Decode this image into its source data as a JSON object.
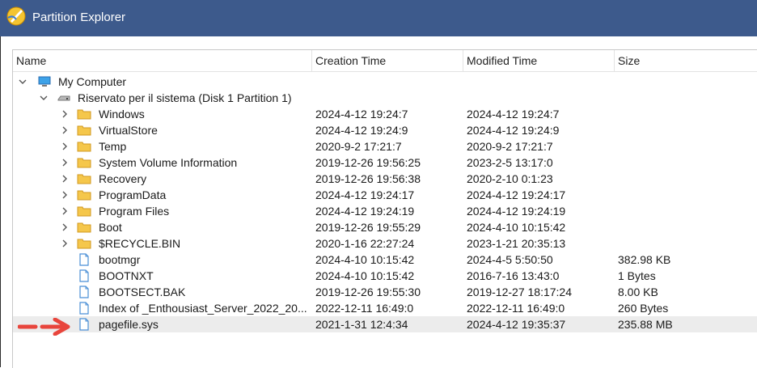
{
  "window": {
    "title": "Partition Explorer"
  },
  "columns": {
    "name": "Name",
    "creation": "Creation Time",
    "modified": "Modified Time",
    "size": "Size"
  },
  "tree": {
    "computer": "My Computer",
    "partition": "Riservato per il sistema (Disk 1 Partition 1)"
  },
  "rows": [
    {
      "name": "Windows",
      "type": "folder",
      "created": "2024-4-12 19:24:7",
      "modified": "2024-4-12 19:24:7",
      "size": ""
    },
    {
      "name": "VirtualStore",
      "type": "folder",
      "created": "2024-4-12 19:24:9",
      "modified": "2024-4-12 19:24:9",
      "size": ""
    },
    {
      "name": "Temp",
      "type": "folder",
      "created": "2020-9-2 17:21:7",
      "modified": "2020-9-2 17:21:7",
      "size": ""
    },
    {
      "name": "System Volume Information",
      "type": "folder",
      "created": "2019-12-26 19:56:25",
      "modified": "2023-2-5 13:17:0",
      "size": ""
    },
    {
      "name": "Recovery",
      "type": "folder",
      "created": "2019-12-26 19:56:38",
      "modified": "2020-2-10 0:1:23",
      "size": ""
    },
    {
      "name": "ProgramData",
      "type": "folder",
      "created": "2024-4-12 19:24:17",
      "modified": "2024-4-12 19:24:17",
      "size": ""
    },
    {
      "name": "Program Files",
      "type": "folder",
      "created": "2024-4-12 19:24:19",
      "modified": "2024-4-12 19:24:19",
      "size": ""
    },
    {
      "name": "Boot",
      "type": "folder",
      "created": "2019-12-26 19:55:29",
      "modified": "2024-4-10 10:15:42",
      "size": ""
    },
    {
      "name": "$RECYCLE.BIN",
      "type": "folder",
      "created": "2020-1-16 22:27:24",
      "modified": "2023-1-21 20:35:13",
      "size": ""
    },
    {
      "name": "bootmgr",
      "type": "file",
      "created": "2024-4-10 10:15:42",
      "modified": "2024-4-5 5:50:50",
      "size": "382.98 KB"
    },
    {
      "name": "BOOTNXT",
      "type": "file",
      "created": "2024-4-10 10:15:42",
      "modified": "2016-7-16 13:43:0",
      "size": "1 Bytes"
    },
    {
      "name": "BOOTSECT.BAK",
      "type": "file",
      "created": "2019-12-26 19:55:30",
      "modified": "2019-12-27 18:17:24",
      "size": "8.00 KB"
    },
    {
      "name": "Index of _Enthousiast_Server_2022_20...",
      "type": "file",
      "created": "2022-12-11 16:49:0",
      "modified": "2022-12-11 16:49:0",
      "size": "260 Bytes"
    },
    {
      "name": "pagefile.sys",
      "type": "file",
      "created": "2021-1-31 12:4:34",
      "modified": "2024-4-12 19:35:37",
      "size": "235.88 MB",
      "selected": true
    }
  ],
  "colors": {
    "titlebar": "#3d5a8c",
    "folder": "#f5c74b",
    "file_accent": "#4a8fd6",
    "arrow": "#e8453c",
    "selection": "#ececec"
  }
}
